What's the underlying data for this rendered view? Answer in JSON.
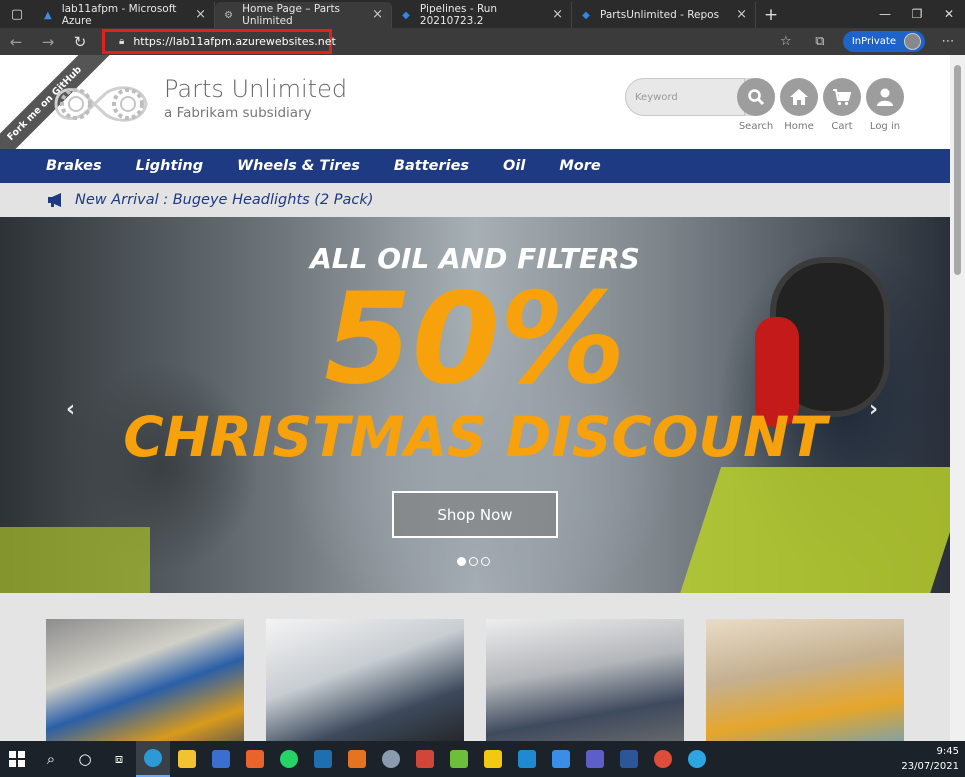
{
  "browser": {
    "tabs": [
      {
        "title": "lab11afpm - Microsoft Azure",
        "icon": "azure-icon",
        "active": false
      },
      {
        "title": "Home Page – Parts Unlimited",
        "icon": "parts-unlimited-icon",
        "active": true
      },
      {
        "title": "Pipelines - Run 20210723.2",
        "icon": "azure-devops-icon",
        "active": false
      },
      {
        "title": "PartsUnlimited - Repos",
        "icon": "azure-devops-icon",
        "active": false
      }
    ],
    "url": "https://lab11afpm.azurewebsites.net",
    "inprivate_label": "InPrivate"
  },
  "site": {
    "fork_ribbon": "Fork me on GitHub",
    "brand_title": "Parts Unlimited",
    "brand_subtitle": "a Fabrikam subsidiary",
    "search_placeholder": "Keyword",
    "header_buttons": [
      {
        "label": "Search",
        "icon": "search-icon"
      },
      {
        "label": "Home",
        "icon": "home-icon"
      },
      {
        "label": "Cart",
        "icon": "cart-icon"
      },
      {
        "label": "Log in",
        "icon": "user-icon"
      }
    ],
    "categories": [
      "Brakes",
      "Lighting",
      "Wheels & Tires",
      "Batteries",
      "Oil",
      "More"
    ],
    "announcement": "New Arrival : Bugeye Headlights (2 Pack)",
    "hero": {
      "headline": "ALL OIL AND FILTERS",
      "percent": "50%",
      "discount": "CHRISTMAS DISCOUNT",
      "button": "Shop Now",
      "slide_count": 3,
      "active_slide": 1
    }
  },
  "colors": {
    "nav_blue": "#1d3a83",
    "hero_orange": "#f7a10c",
    "highlight_red": "#e0221b",
    "inprivate_blue": "#1d63c9"
  },
  "taskbar": {
    "time": "9:45",
    "date": "23/07/2021"
  }
}
